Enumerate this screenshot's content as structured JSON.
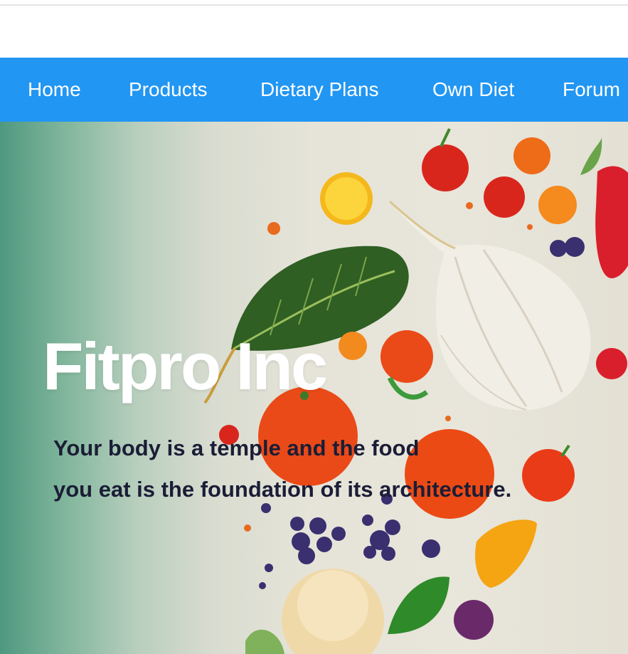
{
  "nav": {
    "items": [
      {
        "label": "Home"
      },
      {
        "label": "Products"
      },
      {
        "label": "Dietary Plans"
      },
      {
        "label": "Own Diet"
      },
      {
        "label": "Forum"
      }
    ]
  },
  "hero": {
    "title": "Fitpro Inc",
    "tagline_lines": [
      "Your body is a temple and the food",
      "you eat is the foundation of its architecture."
    ]
  },
  "colors": {
    "nav_background": "#2196f3",
    "nav_text": "#ffffff",
    "title_text": "#ffffff",
    "tagline_text": "#1b1d36"
  }
}
